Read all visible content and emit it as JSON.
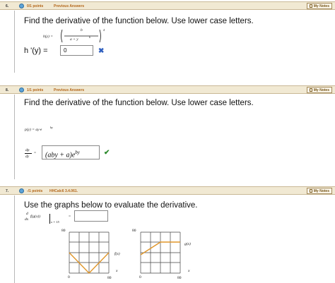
{
  "questions": [
    {
      "number": "6.",
      "points": "0/1 points",
      "link": "Previous Answers",
      "notes_label": "My Notes",
      "prompt": "Find the derivative of the function below. Use lower case letters.",
      "func_lhs": "h(y) =",
      "func_num": "b",
      "func_den": "a + y",
      "func_den_exp": "6",
      "func_power": "4",
      "answer_label": "h '(y) =",
      "answer_value": "0",
      "status": "✖"
    },
    {
      "number": "8.",
      "points": "1/1 points",
      "link": "Previous Answers",
      "notes_label": "My Notes",
      "prompt": "Find the derivative of the function below. Use lower case letters.",
      "func_def": "p(y) = ay·e",
      "func_exp": "by",
      "deriv_num": "dp",
      "deriv_den": "dy",
      "answer_value": "(aby + a)e",
      "answer_exp": "by",
      "status": "✔"
    },
    {
      "number": "7.",
      "points": "-/1 points",
      "link": "HHCalc6 3.4.061.",
      "notes_label": "My Notes",
      "prompt": "Use the graphs below to evaluate the derivative.",
      "deriv_top": "d",
      "deriv_bottom": "dx",
      "deriv_expr": "f(g(x))",
      "eval_at": "x = 15",
      "graph_f": {
        "y_top": "80",
        "x_origin": "0",
        "x_end": "80",
        "axis_x": "x",
        "label": "f(x)"
      },
      "graph_g": {
        "y_top": "80",
        "x_origin": "0",
        "x_end": "80",
        "axis_x": "x",
        "label": "g(x)"
      }
    }
  ],
  "colors": {
    "header_bg": "#f1e9d3",
    "points_text": "#b3661a",
    "graph_line": "#e0962a",
    "correct": "#2e8b2e",
    "incorrect": "#2f5fbf"
  }
}
